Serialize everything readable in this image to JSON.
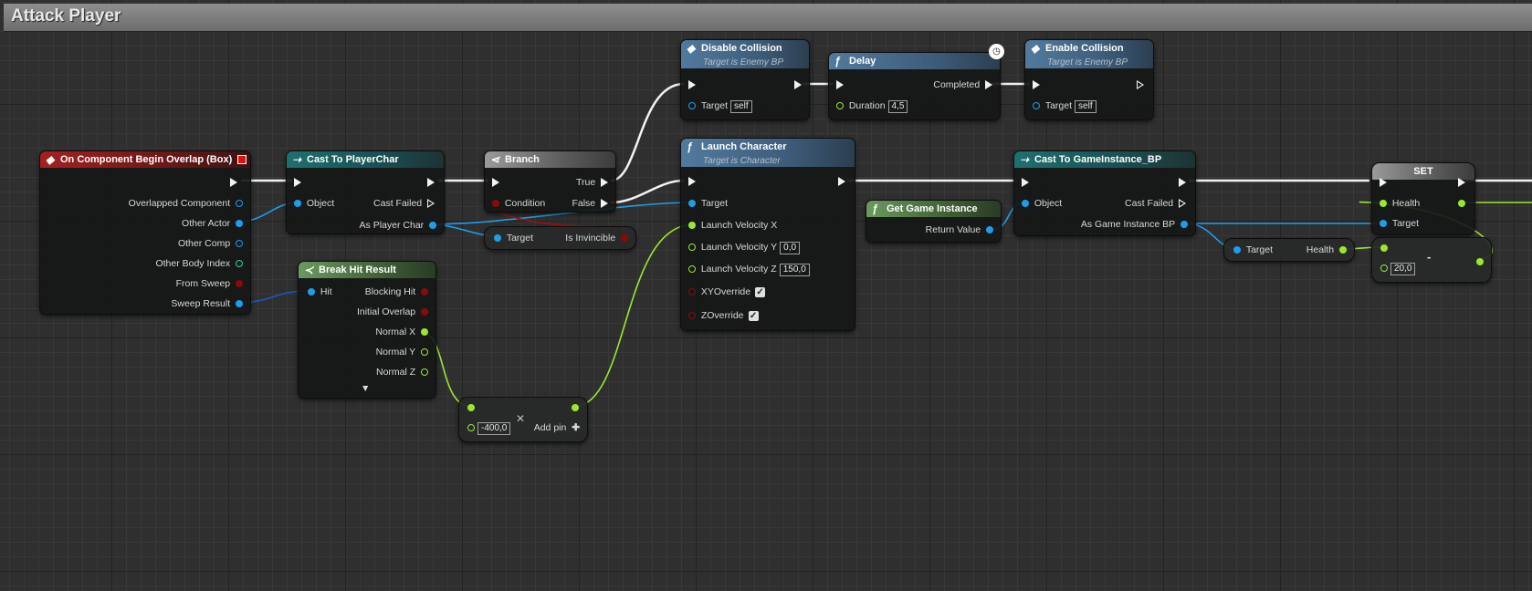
{
  "graph": {
    "title": "Attack Player"
  },
  "colors": {
    "exec": "#f2f2f2",
    "object": "#1e9ee8",
    "float": "#9ee62e",
    "bool": "#8a0a0a",
    "struct": "#2ecfa0"
  },
  "nodes": {
    "event": {
      "title": "On Component Begin Overlap (Box)",
      "pins": [
        "Overlapped Component",
        "Other Actor",
        "Other Comp",
        "Other Body Index",
        "From Sweep",
        "Sweep Result"
      ]
    },
    "cast_player": {
      "title": "Cast To PlayerChar",
      "object": "Object",
      "cast_failed": "Cast Failed",
      "as": "As Player Char"
    },
    "branch": {
      "title": "Branch",
      "condition": "Condition",
      "true_label": "True",
      "false_label": "False"
    },
    "is_invincible": {
      "target": "Target",
      "output": "Is Invincible"
    },
    "break_hit": {
      "title": "Break Hit Result",
      "input": "Hit",
      "outputs": [
        "Blocking Hit",
        "Initial Overlap",
        "Normal X",
        "Normal Y",
        "Normal Z"
      ]
    },
    "add_node": {
      "value": "-400,0",
      "add_pin": "Add pin"
    },
    "disable_collision": {
      "title": "Disable Collision",
      "subtitle": "Target is Enemy BP",
      "target": "Target",
      "self": "self"
    },
    "delay": {
      "title": "Delay",
      "completed": "Completed",
      "duration": "Duration",
      "duration_value": "4,5"
    },
    "enable_collision": {
      "title": "Enable Collision",
      "subtitle": "Target is Enemy BP",
      "target": "Target",
      "self": "self"
    },
    "launch": {
      "title": "Launch Character",
      "subtitle": "Target is Character",
      "target": "Target",
      "vx": "Launch Velocity X",
      "vy": "Launch Velocity Y",
      "vy_value": "0,0",
      "vz": "Launch Velocity Z",
      "vz_value": "150,0",
      "xy": "XYOverride",
      "z": "ZOverride"
    },
    "get_game_instance": {
      "title": "Get Game Instance",
      "return": "Return Value"
    },
    "cast_gi": {
      "title": "Cast To GameInstance_BP",
      "object": "Object",
      "cast_failed": "Cast Failed",
      "as": "As Game Instance BP"
    },
    "get_health": {
      "target": "Target",
      "output": "Health"
    },
    "set_node": {
      "title": "SET",
      "health": "Health",
      "target": "Target"
    },
    "sub_node": {
      "symbol": "-",
      "value": "20,0"
    }
  },
  "icons": [
    "function-icon",
    "cast-icon",
    "branch-icon",
    "event-icon",
    "break-icon",
    "clock-icon",
    "remove-icon",
    "add-icon",
    "chevron-down-icon"
  ]
}
